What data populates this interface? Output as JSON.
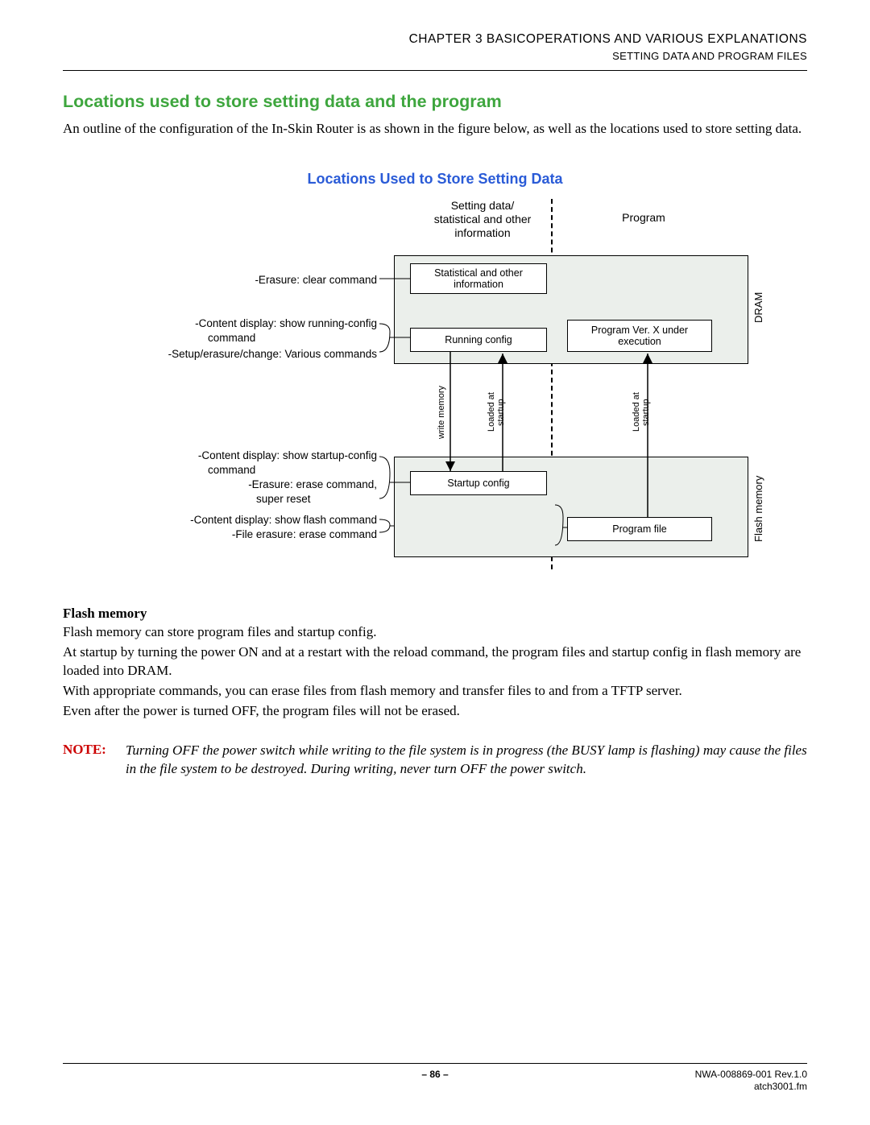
{
  "header": {
    "chapter": "CHAPTER 3   BASICOPERATIONS AND VARIOUS EXPLANATIONS",
    "section": "SETTING DATA AND PROGRAM FILES"
  },
  "h1": "Locations used to store setting data and the program",
  "intro": "An outline of the configuration of the In-Skin Router is as shown in the figure below, as well as the locations used to store setting data.",
  "h2": "Locations Used to Store Setting Data",
  "diagram": {
    "col1_header": "Setting data/\nstatistical and other\ninformation",
    "col2_header": "Program",
    "dram_label": "DRAM",
    "flash_label": "Flash memory",
    "box_stat": "Statistical and other\ninformation",
    "box_running": "Running config",
    "box_progx": "Program Ver. X under\nexecution",
    "box_startup": "Startup config",
    "box_progfile": "Program file",
    "arrow_write": "write memory",
    "arrow_loaded1": "Loaded at\nstartup",
    "arrow_loaded2": "Loaded at\nstartup",
    "annot": {
      "a1": "-Erasure:  clear command",
      "a2a": "-Content display:  show running-config",
      "a2b": "command",
      "a3": "-Setup/erasure/change:  Various commands",
      "a4a": "-Content display:  show startup-config",
      "a4b": "command",
      "a5a": "-Erasure:  erase command,",
      "a5b": "super reset",
      "a6": "-Content display:  show flash command",
      "a7": "-File erasure:  erase command"
    }
  },
  "flash": {
    "subhead": "Flash memory",
    "p1": "Flash memory can store program files and startup config.",
    "p2": "At startup by turning the power ON and at a restart with the reload command, the program files and startup config in flash memory are loaded into DRAM.",
    "p3": "With appropriate commands, you can erase files from flash memory and transfer files to and from a TFTP server.",
    "p4": "Even after the power is turned OFF, the program files will not be erased."
  },
  "note": {
    "label": "NOTE:",
    "text": "Turning OFF the power switch while writing to the file system is in progress (the BUSY lamp is flashing) may cause the files in the file system to be destroyed. During writing, never turn OFF the power switch."
  },
  "footer": {
    "page": "– 86 –",
    "doc": "NWA-008869-001 Rev.1.0",
    "file": "atch3001.fm"
  }
}
